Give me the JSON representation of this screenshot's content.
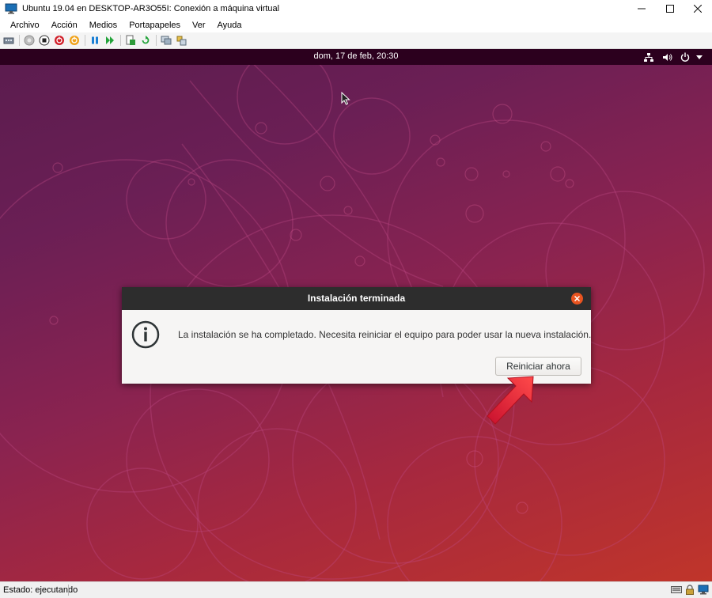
{
  "window": {
    "title": "Ubuntu 19.04 en DESKTOP-AR3O55I: Conexión a máquina virtual"
  },
  "menu": [
    "Archivo",
    "Acción",
    "Medios",
    "Portapapeles",
    "Ver",
    "Ayuda"
  ],
  "toolbar_icons": [
    "ctrl-alt-del-icon",
    "start-icon",
    "turn-off-icon",
    "shut-down-icon",
    "save-icon",
    "pause-icon",
    "resume-icon",
    "checkpoint-icon",
    "revert-icon",
    "enhanced-session-icon",
    "settings-icon"
  ],
  "ubuntu": {
    "clock": "dom, 17 de feb, 20:30"
  },
  "dialog": {
    "title": "Instalación terminada",
    "message": "La instalación se ha completado. Necesita reiniciar el equipo para poder usar la nueva instalación.",
    "button": "Reiniciar ahora"
  },
  "statusbar": {
    "text": "Estado: ejecutando"
  },
  "colors": {
    "ubuntu_orange": "#e95420",
    "topbar": "#2c001e",
    "dialog_header": "#2d2d2d",
    "arrow": "#e8343a"
  }
}
